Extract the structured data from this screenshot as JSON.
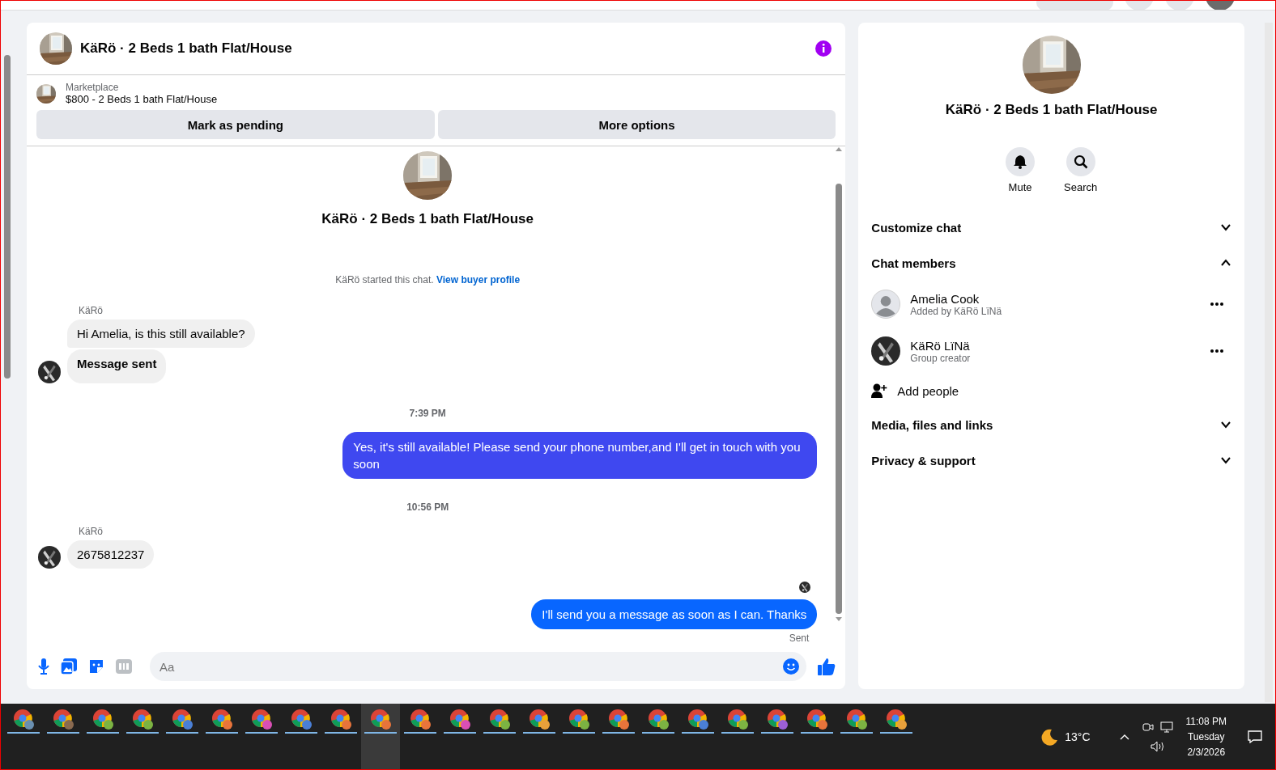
{
  "conversation": {
    "title": "KäRö · 2 Beds 1 bath Flat/House",
    "listing": {
      "label": "Marketplace",
      "title": "$800 - 2 Beds 1 bath Flat/House"
    },
    "actions": [
      "Mark as pending",
      "More options"
    ]
  },
  "thread": {
    "title": "KäRö · 2 Beds 1 bath Flat/House",
    "intro": {
      "text": "KäRö started this chat.",
      "link": "View buyer profile"
    },
    "items": [
      {
        "kind": "sender",
        "text": "KäRö"
      },
      {
        "kind": "incoming",
        "text": "Hi Amelia, is this still available?",
        "avatar": false,
        "bold": false
      },
      {
        "kind": "incoming",
        "text": "Message sent",
        "avatar": true,
        "bold": true
      },
      {
        "kind": "time",
        "text": "7:39 PM"
      },
      {
        "kind": "outgoing",
        "text": "Yes, it's still available! Please send your phone number,and I'll get in touch with you soon",
        "color": "#3f48f0"
      },
      {
        "kind": "time",
        "text": "10:56 PM"
      },
      {
        "kind": "sender",
        "text": "KäRö"
      },
      {
        "kind": "incoming",
        "text": "2675812237",
        "avatar": true,
        "bold": false
      },
      {
        "kind": "seen"
      },
      {
        "kind": "outgoing",
        "text": "I'll send you a message as soon as I can. Thanks",
        "color": "#0866ff"
      },
      {
        "kind": "status",
        "text": "Sent"
      }
    ]
  },
  "composer": {
    "placeholder": "Aa"
  },
  "details": {
    "title": "KäRö · 2 Beds 1 bath Flat/House",
    "actions": [
      "Mute",
      "Search"
    ],
    "sections": [
      {
        "title": "Customize chat",
        "expanded": false
      },
      {
        "title": "Chat members",
        "expanded": true,
        "members": [
          {
            "name": "Amelia Cook",
            "note": "Added by KäRö LïNä",
            "kind": "default"
          },
          {
            "name": "KäRö LïNä",
            "note": "Group creator",
            "kind": "dark"
          }
        ],
        "add": "Add people"
      },
      {
        "title": "Media, files and links",
        "expanded": false
      },
      {
        "title": "Privacy & support",
        "expanded": false
      }
    ]
  },
  "taskbar": {
    "apps": [
      {
        "color": "#6a8fb0",
        "selected": false
      },
      {
        "color": "#8a6a50",
        "selected": false
      },
      {
        "color": "#7cb342",
        "selected": false
      },
      {
        "color": "#7cb342",
        "selected": false
      },
      {
        "color": "#4a7fd6",
        "selected": false
      },
      {
        "color": "#e8743b",
        "selected": false
      },
      {
        "color": "#d94fb5",
        "selected": false
      },
      {
        "color": "#4a7fd6",
        "selected": false
      },
      {
        "color": "#e8743b",
        "selected": false
      },
      {
        "color": "#e8743b",
        "selected": true
      },
      {
        "color": "#e8743b",
        "selected": false
      },
      {
        "color": "#d94fb5",
        "selected": false
      },
      {
        "color": "#7cb342",
        "selected": false
      },
      {
        "color": "#e8a03b",
        "selected": false
      },
      {
        "color": "#7cb342",
        "selected": false
      },
      {
        "color": "#e8743b",
        "selected": false
      },
      {
        "color": "#7cb342",
        "selected": false
      },
      {
        "color": "#4a7fd6",
        "selected": false
      },
      {
        "color": "#7cb342",
        "selected": false
      },
      {
        "color": "#9c5fd6",
        "selected": false
      },
      {
        "color": "#e8743b",
        "selected": false
      },
      {
        "color": "#7cb342",
        "selected": false
      },
      {
        "color": "#e8a03b",
        "selected": false
      }
    ],
    "weather": "13°C",
    "time": "11:08 PM",
    "day": "Tuesday",
    "date": "2/3/2026"
  }
}
